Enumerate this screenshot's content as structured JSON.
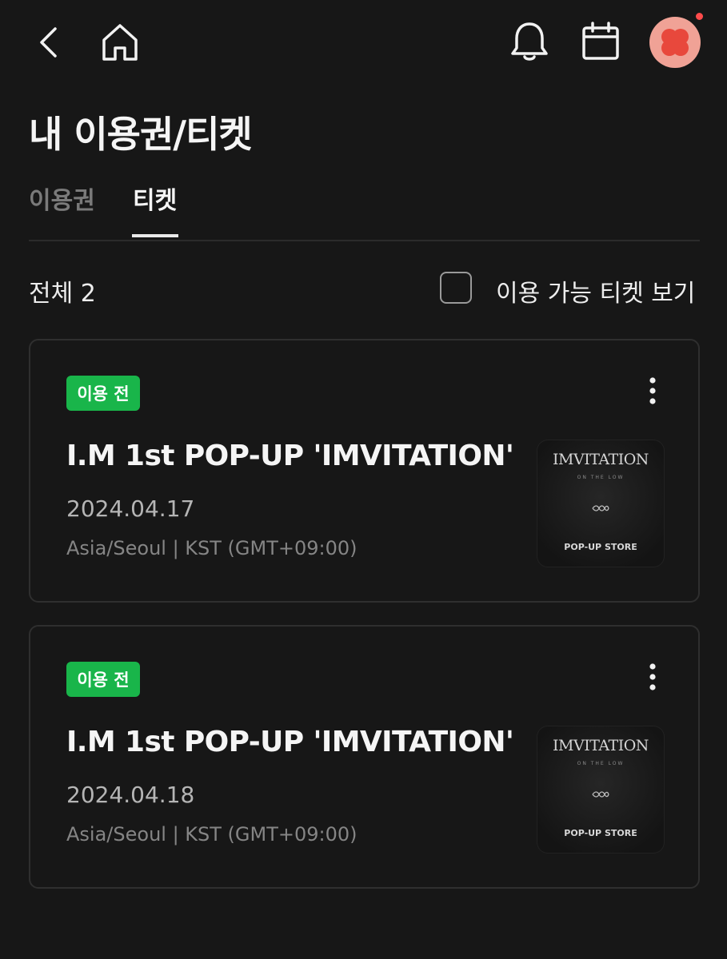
{
  "header": {
    "back_icon": "chevron-left-icon",
    "home_icon": "home-icon",
    "notification_icon": "bell-icon",
    "calendar_icon": "calendar-icon",
    "avatar_icon": "flower-avatar",
    "avatar_color": "#f0a296",
    "notification_dot_color": "#ff4b4b"
  },
  "page": {
    "title": "내 이용권/티켓"
  },
  "tabs": [
    {
      "label": "이용권",
      "active": false
    },
    {
      "label": "티켓",
      "active": true
    }
  ],
  "filter": {
    "total_label": "전체 2",
    "checkbox_label": "이용 가능 티켓 보기",
    "checked": false
  },
  "tickets": [
    {
      "status": "이용 전",
      "status_color": "#19b54a",
      "title": "I.M 1st POP-UP 'IMVITATION'",
      "date": "2024.04.17",
      "timezone": "Asia/Seoul | KST (GMT+09:00)",
      "poster": {
        "title": "IMVITATION",
        "subtitle": "ON THE LOW",
        "footer": "POP-UP STORE"
      }
    },
    {
      "status": "이용 전",
      "status_color": "#19b54a",
      "title": "I.M 1st POP-UP 'IMVITATION'",
      "date": "2024.04.18",
      "timezone": "Asia/Seoul | KST (GMT+09:00)",
      "poster": {
        "title": "IMVITATION",
        "subtitle": "ON THE LOW",
        "footer": "POP-UP STORE"
      }
    }
  ]
}
